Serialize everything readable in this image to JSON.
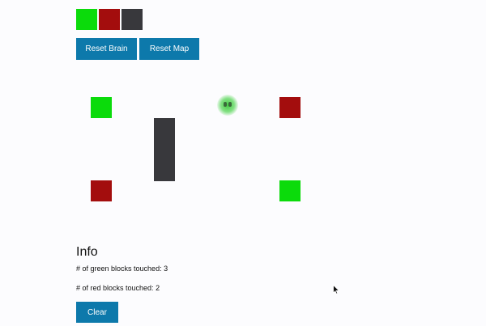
{
  "palette": [
    {
      "name": "green",
      "color": "#0bdb0b"
    },
    {
      "name": "red",
      "color": "#a30d0d"
    },
    {
      "name": "wall",
      "color": "#38383c"
    }
  ],
  "buttons": {
    "reset_brain": "Reset Brain",
    "reset_map": "Reset Map",
    "clear": "Clear"
  },
  "map": {
    "green_color": "#0bdb0b",
    "red_color": "#a30d0d",
    "wall_color": "#38383c",
    "agent_color": "#4fd24f"
  },
  "info": {
    "title": "Info",
    "green_label": "# of green blocks touched: ",
    "green_count": "3",
    "red_label": "# of red blocks touched: ",
    "red_count": "2"
  },
  "accent_color": "#0d79ab"
}
